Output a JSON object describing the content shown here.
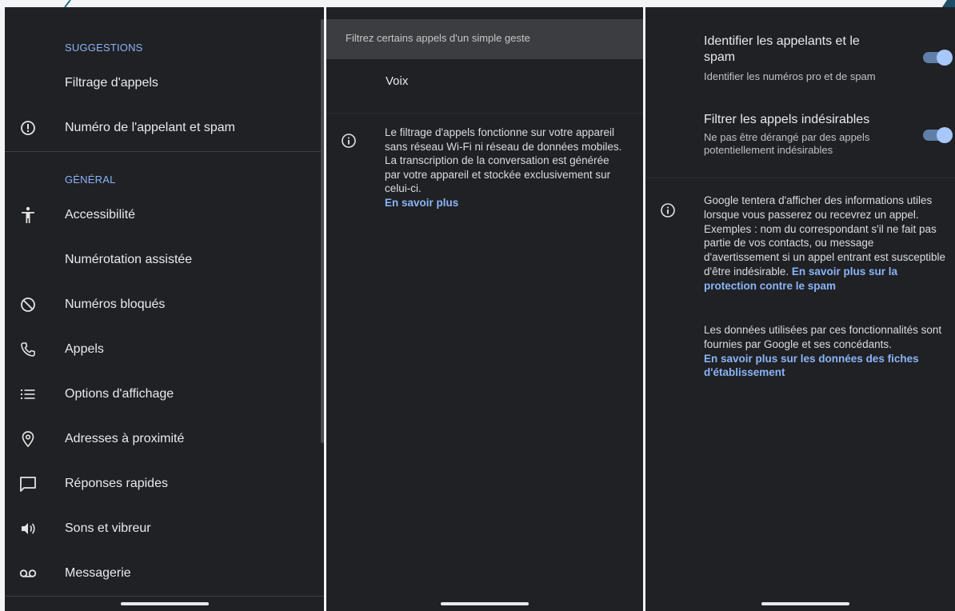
{
  "panel1": {
    "section_suggestions": "SUGGESTIONS",
    "section_general": "GÉNÉRAL",
    "items": [
      {
        "label": "Filtrage d'appels",
        "icon": "none"
      },
      {
        "label": "Numéro de l'appelant et spam",
        "icon": "alert-circle-icon"
      },
      {
        "label": "Accessibilité",
        "icon": "accessibility-icon"
      },
      {
        "label": "Numérotation assistée",
        "icon": "none"
      },
      {
        "label": "Numéros bloqués",
        "icon": "block-icon"
      },
      {
        "label": "Appels",
        "icon": "phone-icon"
      },
      {
        "label": "Options d'affichage",
        "icon": "list-icon"
      },
      {
        "label": "Adresses à proximité",
        "icon": "location-icon"
      },
      {
        "label": "Réponses rapides",
        "icon": "message-icon"
      },
      {
        "label": "Sons et vibreur",
        "icon": "volume-icon"
      },
      {
        "label": "Messagerie",
        "icon": "voicemail-icon"
      }
    ]
  },
  "panel2": {
    "header": "Filtrez certains appels d'un simple geste",
    "voice_label": "Voix",
    "info_text": "Le filtrage d'appels fonctionne sur votre appareil sans réseau Wi-Fi ni réseau de données mobiles. La transcription de la conversation est générée par votre appareil et stockée exclusivement sur celui-ci.",
    "info_link": "En savoir plus"
  },
  "panel3": {
    "toggle1": {
      "title": "Identifier les appelants et le spam",
      "subtitle": "Identifier les numéros pro et de spam",
      "state": "on"
    },
    "toggle2": {
      "title": "Filtrer les appels indésirables",
      "subtitle": "Ne pas être dérangé par des appels potentiellement indésirables",
      "state": "on"
    },
    "info_text1": "Google tentera d'afficher des informations utiles lorsque vous passerez ou recevrez un appel. Exemples : nom du correspondant s'il ne fait pas partie de vos contacts, ou message d'avertissement si un appel entrant est susceptible d'être indésirable.",
    "info_link1": "En savoir plus sur la protection contre le spam",
    "info_text2": "Les données utilisées par ces fonctionnalités sont fournies par Google et ses concédants.",
    "info_link2": "En savoir plus sur les données des fiches d'établissement"
  },
  "colors": {
    "background": "#202124",
    "accent": "#8ab4f8",
    "toggle_knob": "#a8c7fa"
  }
}
